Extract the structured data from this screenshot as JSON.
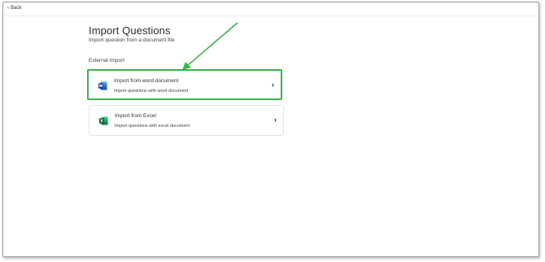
{
  "nav": {
    "back_label": "Back"
  },
  "page": {
    "title": "Import Questions",
    "subtitle": "Import question from a document file",
    "section_label": "External Import"
  },
  "options": [
    {
      "title": "Import from word document",
      "description": "Import questions with word document",
      "icon": "word-icon",
      "icon_color": "#2b579a",
      "highlighted": true
    },
    {
      "title": "Import from Excel",
      "description": "Import questions with excel document",
      "icon": "excel-icon",
      "icon_color": "#217346",
      "highlighted": false
    }
  ],
  "annotation": {
    "color": "#3bb54a"
  }
}
